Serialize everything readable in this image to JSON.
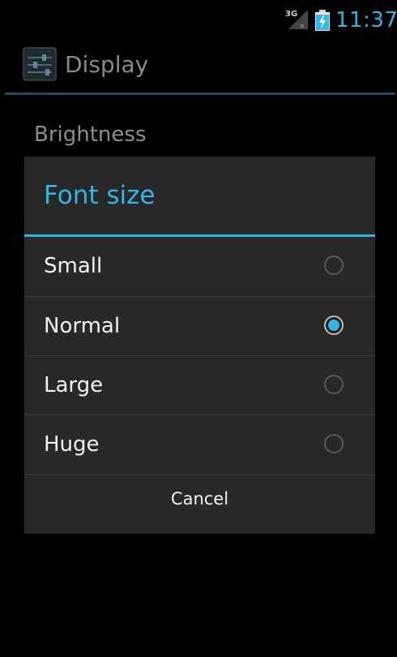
{
  "status_bar": {
    "network": "3G",
    "time": "11:37",
    "accent_color": "#33b5e5"
  },
  "action_bar": {
    "title": "Display",
    "icon": "settings-sliders-icon"
  },
  "background": {
    "list_item": "Brightness"
  },
  "dialog": {
    "title": "Font size",
    "options": [
      {
        "label": "Small",
        "selected": false
      },
      {
        "label": "Normal",
        "selected": true
      },
      {
        "label": "Large",
        "selected": false
      },
      {
        "label": "Huge",
        "selected": false
      }
    ],
    "cancel_label": "Cancel"
  },
  "colors": {
    "accent": "#33b5e5",
    "dialog_background": "#282828",
    "screen_background": "#000000"
  }
}
